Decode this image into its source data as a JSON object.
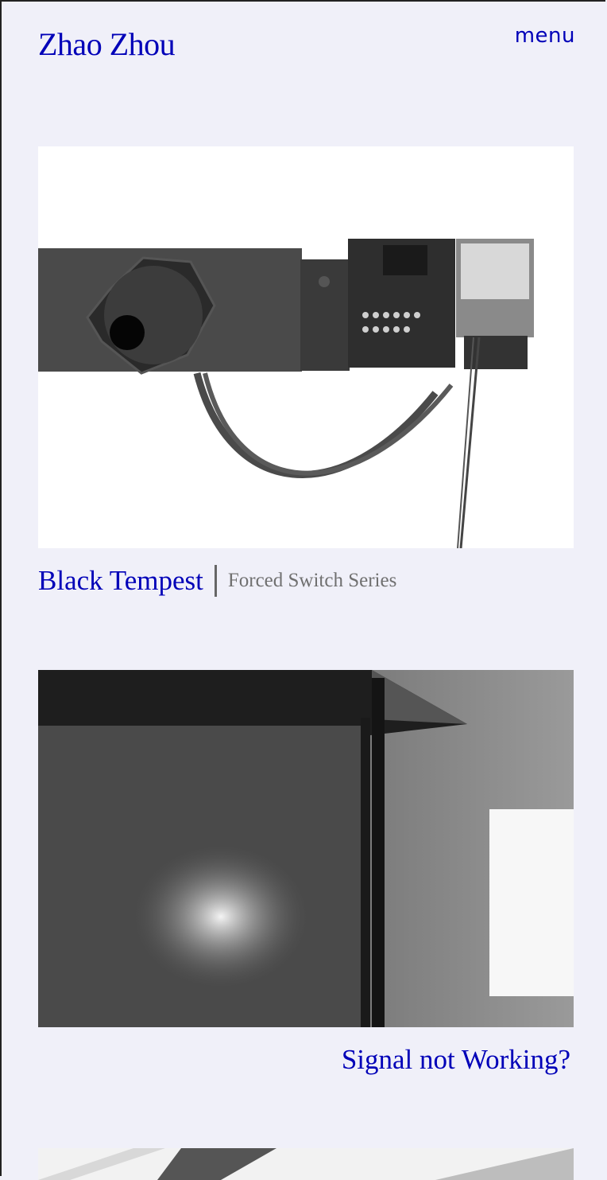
{
  "header": {
    "site_title": "Zhao Zhou",
    "menu_label": "menu"
  },
  "projects": [
    {
      "title": "Black Tempest",
      "series": "Forced Switch Series",
      "image_icon": "speaker-circuit-installation-image"
    },
    {
      "title": "Signal not Working?",
      "series": "",
      "image_icon": "glass-panel-installation-image"
    },
    {
      "title": "",
      "series": "",
      "image_icon": "partial-installation-image"
    }
  ],
  "colors": {
    "background": "#f0f0f9",
    "link": "#0000b8",
    "series_text": "#707070"
  }
}
